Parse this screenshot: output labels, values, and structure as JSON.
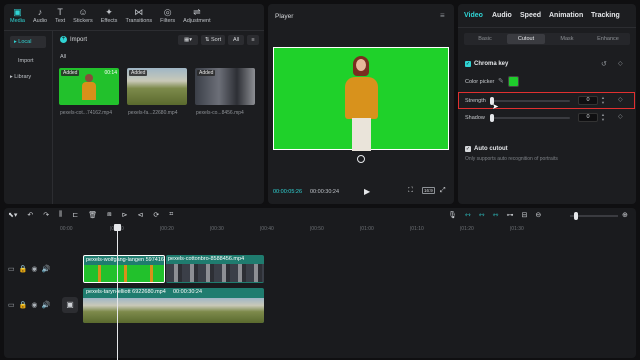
{
  "media_tabs": [
    {
      "label": "Media",
      "icon": "film-icon",
      "active": true
    },
    {
      "label": "Audio",
      "icon": "music-icon"
    },
    {
      "label": "Text",
      "icon": "text-icon"
    },
    {
      "label": "Stickers",
      "icon": "sticker-icon"
    },
    {
      "label": "Effects",
      "icon": "sparkle-icon"
    },
    {
      "label": "Transitions",
      "icon": "transition-icon"
    },
    {
      "label": "Filters",
      "icon": "filter-icon"
    },
    {
      "label": "Adjustment",
      "icon": "adjust-icon"
    }
  ],
  "sidebar": {
    "local": "Local",
    "import": "Import",
    "library": "Library"
  },
  "media_toolbar": {
    "import": "Import",
    "sort": "Sort",
    "all": "All"
  },
  "media_section_label": "All",
  "media_items": [
    {
      "badge": "Added",
      "duration": "00:14",
      "name": "pexels-cot...74162.mp4"
    },
    {
      "badge": "Added",
      "duration": "",
      "name": "pexels-fa...22680.mp4"
    },
    {
      "badge": "Added",
      "duration": "",
      "name": "pexels-co...8456.mp4"
    }
  ],
  "player": {
    "title": "Player",
    "current_time": "00:00:05:26",
    "total_time": "00:00:30:24",
    "ratio": "16:9"
  },
  "props": {
    "tabs": [
      "Video",
      "Audio",
      "Speed",
      "Animation",
      "Tracking"
    ],
    "active_tab": "Video",
    "subtabs": [
      "Basic",
      "Cutout",
      "Mask",
      "Enhance"
    ],
    "active_subtab": "Cutout",
    "chroma_key": "Chroma key",
    "color_picker": "Color picker",
    "picker_color": "#1fcc2c",
    "strength": {
      "label": "Strength",
      "value": "0",
      "level": 0
    },
    "shadow": {
      "label": "Shadow",
      "value": "0",
      "level": 0
    },
    "auto_cutout": "Auto cutout",
    "auto_note": "Only supports auto recognition of portraits"
  },
  "ruler": [
    "00:00",
    "|00:10",
    "|00:20",
    "|00:30",
    "|00:40",
    "|00:50",
    "|01:00",
    "|01:10",
    "|01:20",
    "|01:30"
  ],
  "clips": {
    "top_a": "pexels-wolfgang-langen 597416",
    "top_b": "pexels-cottonbro-8588456.mp4",
    "main": "pexels-taryn-elliott 6922680.mp4",
    "main_duration": "00:00:30:24"
  },
  "colors": {
    "accent": "#30d4d4",
    "green": "#1fcc2c",
    "highlight": "#e03030"
  }
}
